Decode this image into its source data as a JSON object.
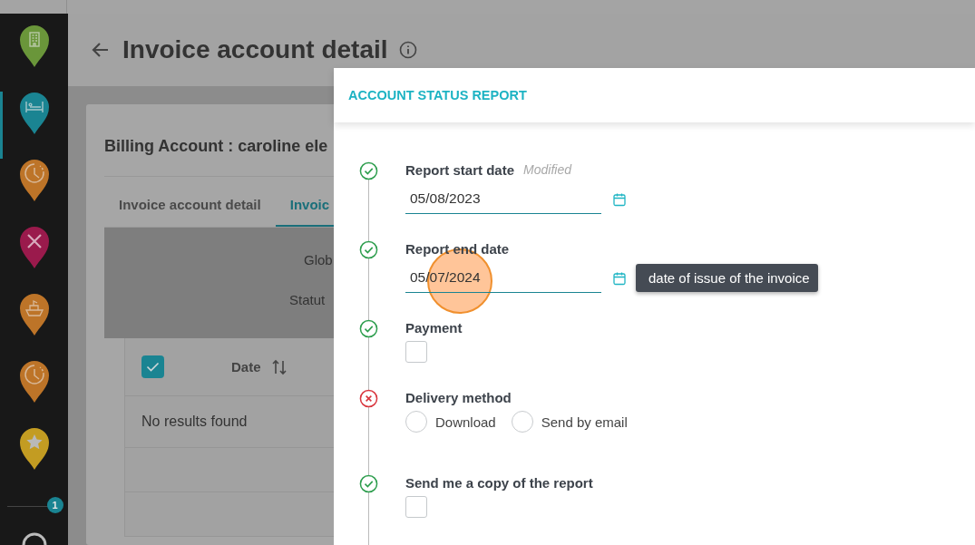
{
  "sidebar": {
    "items": [
      {
        "color": "#6a963a",
        "selected": false
      },
      {
        "color": "#1a8492",
        "selected": true
      },
      {
        "color": "#bd7428",
        "selected": false
      },
      {
        "color": "#9a1a4c",
        "selected": false
      },
      {
        "color": "#bd7428",
        "selected": false
      },
      {
        "color": "#bd7428",
        "selected": false
      },
      {
        "color": "#c39c22",
        "selected": false
      }
    ],
    "badge": "1"
  },
  "page": {
    "title": "Invoice account detail",
    "card": {
      "title": "Billing Account : caroline ele",
      "tabs": [
        {
          "label": "Invoice account detail",
          "selected": false
        },
        {
          "label": "Invoic",
          "selected": true
        }
      ],
      "summary": [
        "Glob",
        "Statut"
      ],
      "table": {
        "select_all_checked": true,
        "columns": [
          {
            "label": "Date"
          }
        ],
        "empty_text": "No results found"
      }
    }
  },
  "modal": {
    "title": "ACCOUNT STATUS REPORT",
    "steps": [
      {
        "kind": "date",
        "valid": true,
        "label": "Report start date",
        "note": "Modified",
        "value": "05/08/2023"
      },
      {
        "kind": "date",
        "valid": true,
        "label": "Report end date",
        "value": "05/07/2024",
        "tooltip": "date of issue of the invoice"
      },
      {
        "kind": "checkbox",
        "valid": true,
        "label": "Payment",
        "checked": false
      },
      {
        "kind": "radio",
        "valid": false,
        "label": "Delivery method",
        "options": [
          {
            "label": "Download",
            "selected": false
          },
          {
            "label": "Send by email",
            "selected": false
          }
        ]
      },
      {
        "kind": "checkbox",
        "valid": true,
        "label": "Send me a copy of the report",
        "checked": false
      }
    ]
  }
}
